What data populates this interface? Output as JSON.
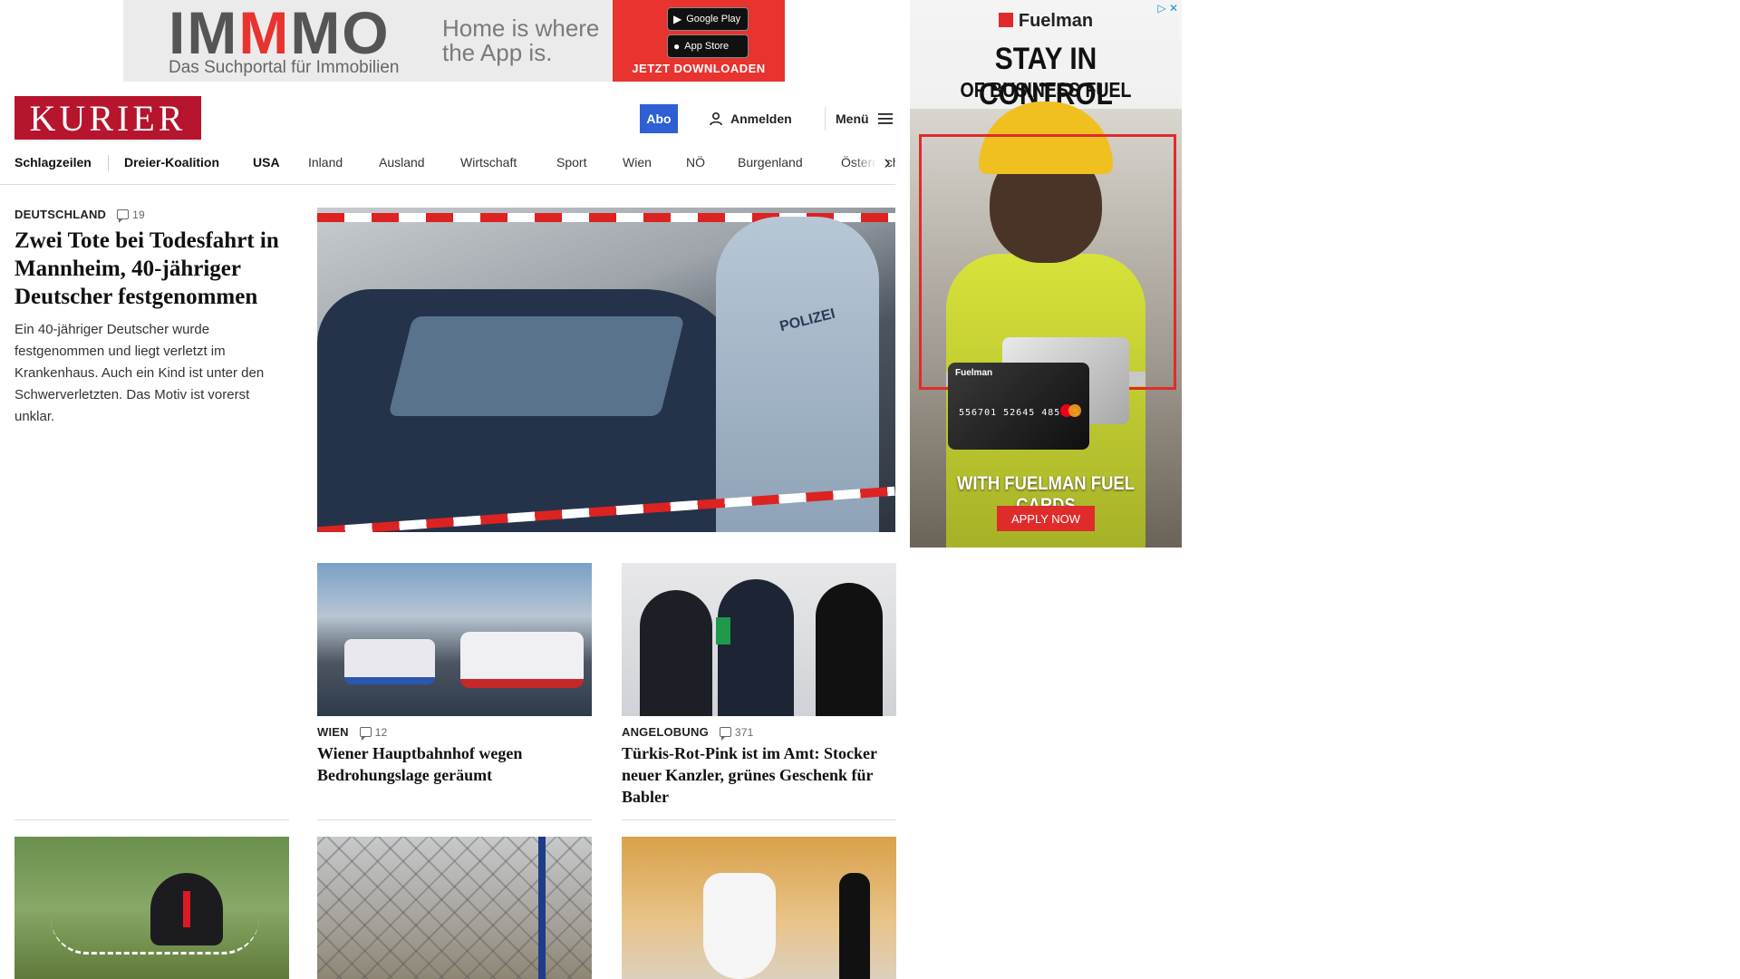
{
  "ad_top": {
    "brand_part1": "IM",
    "brand_part2": "M",
    "brand_part3": "MO",
    "subline": "Das Suchportal für Immobilien",
    "slogan": "Home is where the App is.",
    "google_play": "Google Play",
    "app_store": "App Store",
    "cta": "JETZT DOWNLOADEN"
  },
  "ad_side": {
    "brand": "Fuelman",
    "headline1": "STAY IN CONTROL",
    "headline2": "OF BUSINESS FUEL COSTS",
    "card_brand": "Fuelman",
    "card_number": "556701 52645 485145",
    "tagline": "WITH FUELMAN FUEL CARDS",
    "cta": "APPLY NOW",
    "accent_color": "#e02b2b"
  },
  "header": {
    "logo": "KURIER",
    "abo_label": "Abo",
    "login_label": "Anmelden",
    "menu_label": "Menü",
    "brand_color": "#b7142e",
    "abo_color": "#2e5fd3"
  },
  "nav": {
    "items": [
      "Schlagzeilen",
      "Dreier-Koalition",
      "USA",
      "Inland",
      "Ausland",
      "Wirtschaft",
      "Sport",
      "Wien",
      "NÖ",
      "Burgenland",
      "Österreich"
    ]
  },
  "lead": {
    "kicker": "Deutschland",
    "comments": "19",
    "title": "Zwei Tote bei Todesfahrt in Mannheim, 40-jähriger Deutscher festgenommen",
    "teaser": "Ein 40-jähriger Deutscher wurde festgenommen und liegt verletzt im Krankenhaus. Auch ein Kind ist unter den Schwerverletzten. Das Motiv ist vorerst unklar.",
    "image_text": "POLIZEI"
  },
  "cards": [
    {
      "kicker": "Wien",
      "comments": "12",
      "title": "Wiener Hauptbahnhof wegen Bedrohungslage geräumt"
    },
    {
      "kicker": "Angelobung",
      "comments": "371",
      "title": "Türkis-Rot-Pink ist im Amt: Stocker neuer Kanzler, grünes Geschenk für Babler"
    }
  ],
  "icons": {
    "user": "user-icon",
    "menu": "hamburger-icon",
    "comment": "comment-icon",
    "nav_next": "chevron-right-icon"
  }
}
